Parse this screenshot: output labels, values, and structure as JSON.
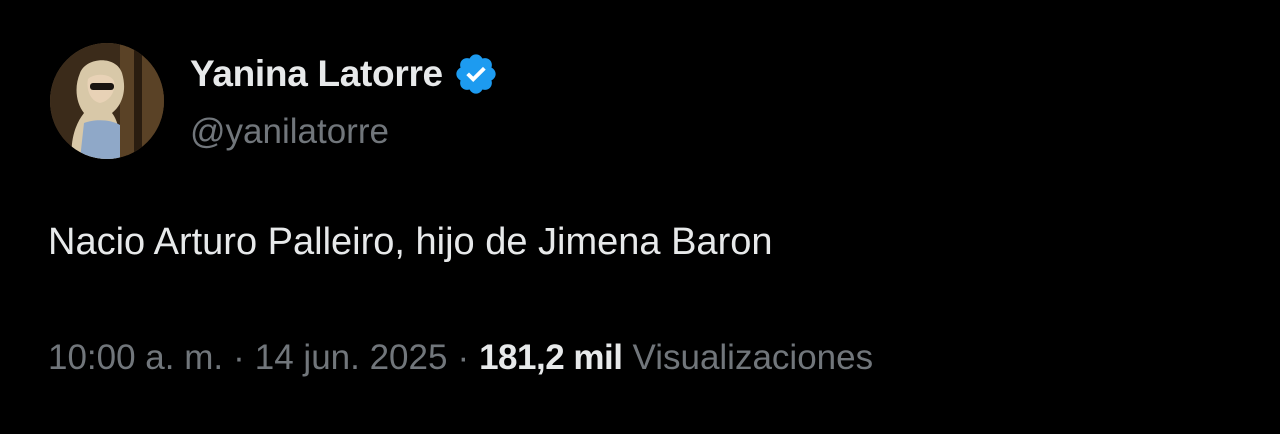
{
  "author": {
    "display_name": "Yanina Latorre",
    "handle": "@yanilatorre",
    "verified_icon": "verified-badge-icon",
    "verified_color": "#1d9bf0",
    "avatar_icon": "profile-photo"
  },
  "tweet": {
    "text": "Nacio Arturo Palleiro, hijo de Jimena Baron"
  },
  "meta": {
    "time": "10:00 a. m.",
    "separator": "·",
    "date": "14 jun. 2025",
    "views_count": "181,2 mil",
    "views_label": "Visualizaciones"
  },
  "colors": {
    "background": "#000000",
    "primary_text": "#e7e9ea",
    "secondary_text": "#71767b"
  }
}
